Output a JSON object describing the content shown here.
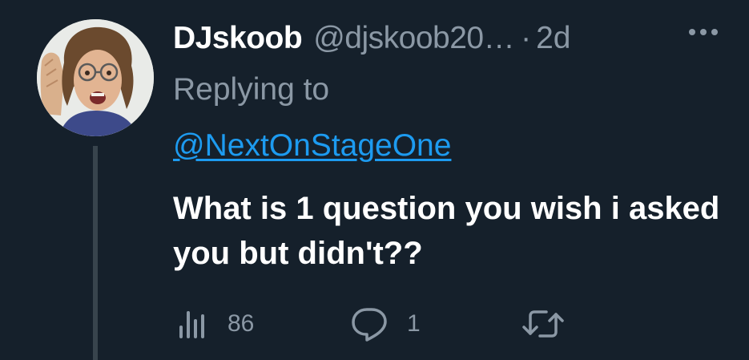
{
  "tweet": {
    "display_name": "DJskoob",
    "handle": "@djskoob20…",
    "separator": "·",
    "time": "2d",
    "replying_label": "Replying to",
    "replying_to": "@NextOnStageOne",
    "text": "What is 1 question you wish i asked you but didn't??",
    "views": "86",
    "replies": "1"
  },
  "icons": {
    "avatar": "avatar",
    "more": "more-icon",
    "views": "views-icon",
    "reply": "reply-icon",
    "retweet": "retweet-icon"
  },
  "colors": {
    "background": "#15202b",
    "text_primary": "#ffffff",
    "text_secondary": "#8b98a5",
    "link": "#1d9bf0",
    "thread_line": "#38444d"
  }
}
